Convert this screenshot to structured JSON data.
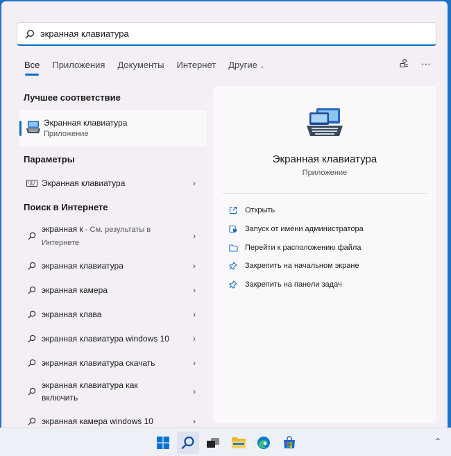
{
  "search": {
    "value": "экранная клавиатура"
  },
  "tabs": [
    {
      "label": "Все"
    },
    {
      "label": "Приложения"
    },
    {
      "label": "Документы"
    },
    {
      "label": "Интернет"
    },
    {
      "label": "Другие"
    }
  ],
  "sections": {
    "best_match": "Лучшее соответствие",
    "settings": "Параметры",
    "web": "Поиск в Интернете"
  },
  "best_match": {
    "title": "Экранная клавиатура",
    "subtitle": "Приложение"
  },
  "settings_item": {
    "label": "Экранная клавиатура"
  },
  "web_results": [
    {
      "label": "экранная к",
      "suffix": " - См. результаты в",
      "sub": "Интернете"
    },
    {
      "label": "экранная клавиатура"
    },
    {
      "label": "экранная камера"
    },
    {
      "label": "экранная клава"
    },
    {
      "label": "экранная клавиатура windows 10"
    },
    {
      "label": "экранная клавиатура скачать"
    },
    {
      "label": "экранная клавиатура как",
      "line2": "включить"
    },
    {
      "label": "экранная камера windows 10"
    }
  ],
  "detail": {
    "title": "Экранная клавиатура",
    "subtitle": "Приложение",
    "actions": [
      {
        "label": "Открыть",
        "icon": "open-icon"
      },
      {
        "label": "Запуск от имени администратора",
        "icon": "shield-icon"
      },
      {
        "label": "Перейти к расположению файла",
        "icon": "folder-icon"
      },
      {
        "label": "Закрепить на начальном экране",
        "icon": "pin-icon"
      },
      {
        "label": "Закрепить на панели задач",
        "icon": "pin-icon"
      }
    ]
  },
  "colors": {
    "accent": "#0f6cbd",
    "panel": "#f3eff5",
    "desktop": "#1e73c8"
  }
}
